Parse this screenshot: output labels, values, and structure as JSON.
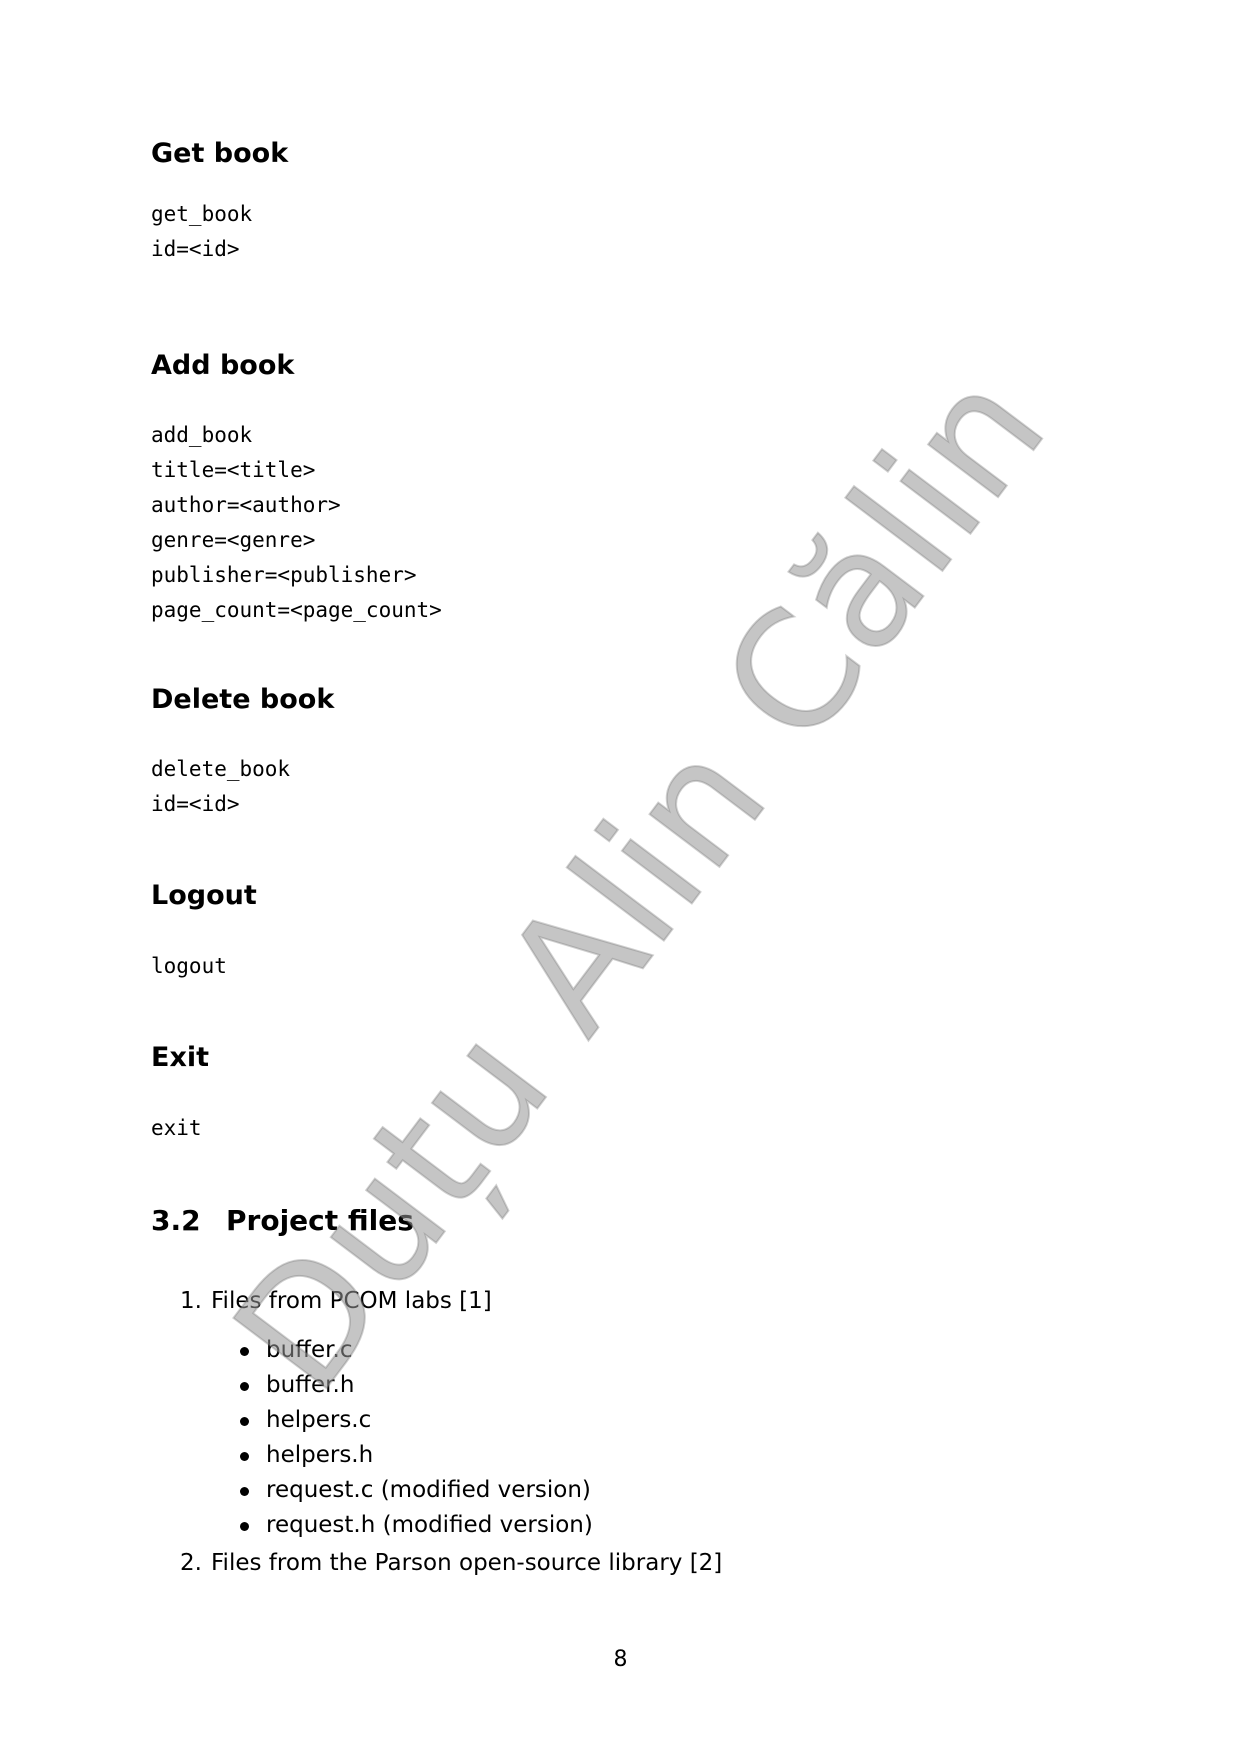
{
  "sections": [
    {
      "heading": "Get book",
      "code": [
        "get_book",
        "id=<id>"
      ]
    },
    {
      "heading": "Add book",
      "code": [
        "add_book",
        "title=<title>",
        "author=<author>",
        "genre=<genre>",
        "publisher=<publisher>",
        "page_count=<page_count>"
      ]
    },
    {
      "heading": "Delete book",
      "code": [
        "delete_book",
        "id=<id>"
      ]
    },
    {
      "heading": "Logout",
      "code": [
        "logout"
      ]
    },
    {
      "heading": "Exit",
      "code": [
        "exit"
      ]
    }
  ],
  "subsection": {
    "number": "3.2",
    "title": "Project files"
  },
  "project_files": [
    {
      "number": "1.",
      "text": "Files from PCOM labs [1]",
      "items": [
        "buffer.c",
        "buffer.h",
        "helpers.c",
        "helpers.h",
        "request.c (modified version)",
        "request.h (modified version)"
      ]
    },
    {
      "number": "2.",
      "text": "Files from the Parson open-source library [2]"
    }
  ],
  "page_number": "8",
  "watermark": "Duțu Alin Călin"
}
